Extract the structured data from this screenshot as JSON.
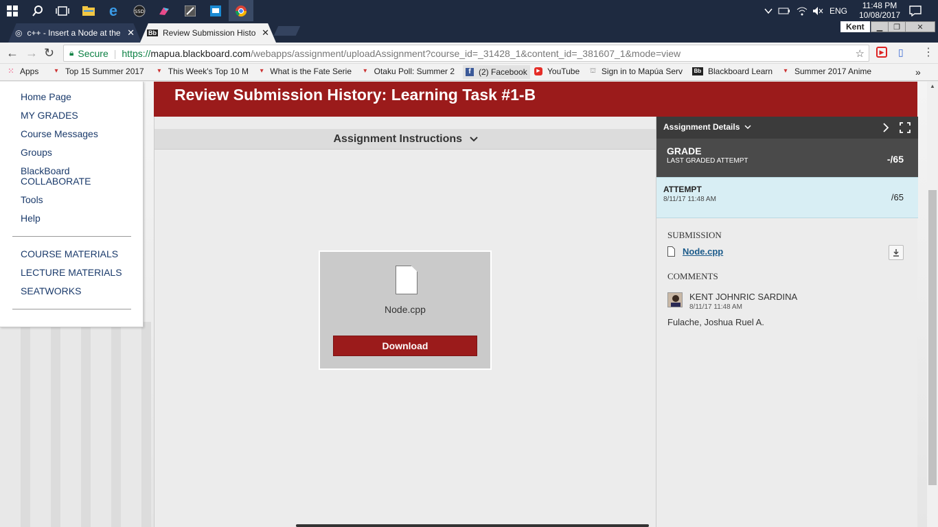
{
  "taskbar": {
    "clock_time": "11:48 PM",
    "clock_date": "10/08/2017",
    "lang": "ENG",
    "icons": [
      "windows-icon",
      "search-icon",
      "task-view-icon",
      "file-explorer-icon",
      "edge-icon",
      "ssd-icon",
      "paint-icon",
      "app-icon",
      "app2-icon",
      "chrome-icon"
    ]
  },
  "browser": {
    "tabs": [
      {
        "title": "c++ - Insert a Node at the"
      },
      {
        "title": "Review Submission Histo"
      }
    ],
    "profile": "Kent",
    "secure_label": "Secure",
    "url_scheme": "https://",
    "url_host": "mapua.blackboard.com",
    "url_path": "/webapps/assignment/uploadAssignment?course_id=_31428_1&content_id=_381607_1&mode=view",
    "bookmarks": [
      {
        "label": "Apps"
      },
      {
        "label": "Top 15 Summer 2017"
      },
      {
        "label": "This Week's Top 10 M"
      },
      {
        "label": "What is the Fate Serie"
      },
      {
        "label": "Otaku Poll: Summer 2"
      },
      {
        "label": "(2) Facebook"
      },
      {
        "label": "YouTube"
      },
      {
        "label": "Sign in to Mapúa Serv"
      },
      {
        "label": "Blackboard Learn"
      },
      {
        "label": "Summer 2017 Anime"
      }
    ],
    "more_bookmarks": "»"
  },
  "sidebar": {
    "items": [
      {
        "label": "Home Page"
      },
      {
        "label": "MY GRADES"
      },
      {
        "label": "Course Messages"
      },
      {
        "label": "Groups"
      },
      {
        "label": "BlackBoard"
      },
      {
        "label": "COLLABORATE"
      },
      {
        "label": "Tools"
      },
      {
        "label": "Help"
      }
    ],
    "items2": [
      {
        "label": "COURSE MATERIALS"
      },
      {
        "label": "LECTURE MATERIALS"
      },
      {
        "label": "SEATWORKS"
      }
    ]
  },
  "page": {
    "title": "Review Submission History: Learning Task #1-B",
    "instructions_label": "Assignment Instructions",
    "file_name": "Node.cpp",
    "download_label": "Download"
  },
  "panel": {
    "header": "Assignment Details",
    "grade_label": "GRADE",
    "grade_sub": "LAST GRADED ATTEMPT",
    "grade_value": "-/65",
    "attempt_label": "ATTEMPT",
    "attempt_date": "8/11/17 11:48 AM",
    "attempt_value": "/65",
    "submission_label": "SUBMISSION",
    "submission_file": "Node.cpp",
    "comments_label": "COMMENTS",
    "comment_author": "KENT JOHNRIC SARDINA",
    "comment_date": "8/11/17 11:48 AM",
    "comment_text": "Fulache, Joshua Ruel A."
  },
  "colors": {
    "brand_red": "#9b1b1b",
    "taskbar": "#1e2a40",
    "attempt_bg": "#d8eef4"
  }
}
